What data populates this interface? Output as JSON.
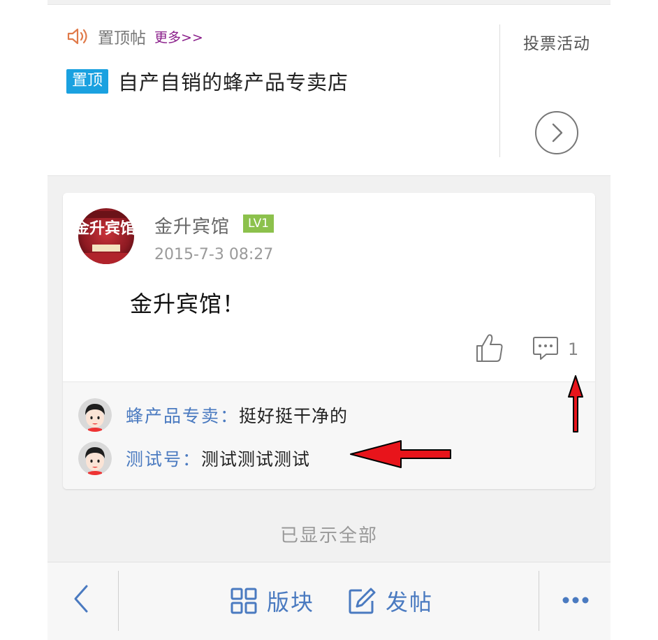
{
  "sticky_section": {
    "label": "置顶帖",
    "more_link": "更多>>",
    "pinned_badge": "置顶",
    "pinned_title": "自产自销的蜂产品专卖店"
  },
  "side_panel": {
    "label": "投票活动"
  },
  "post": {
    "avatar_text": "金升宾馆",
    "author": "金升宾馆",
    "level": "LV1",
    "date": "2015-7-3 08:27",
    "body": "金升宾馆！",
    "comment_count": "1"
  },
  "comments": [
    {
      "user": "蜂产品专卖：",
      "text": "挺好挺干净的"
    },
    {
      "user": "测试号：",
      "text": "测试测试测试"
    }
  ],
  "footer_note": "已显示全部",
  "toolbar": {
    "sections_label": "版块",
    "post_label": "发帖"
  },
  "colors": {
    "accent_blue": "#4a7ac0",
    "badge_blue": "#1aa1e0",
    "level_green": "#8cc14c",
    "annotation_red": "#e8141b"
  },
  "icons": [
    "speaker-icon",
    "chevron-right-circle-icon",
    "thumbs-up-icon",
    "comment-icon",
    "back-chevron-icon",
    "grid-icon",
    "edit-icon",
    "more-dots-icon"
  ]
}
